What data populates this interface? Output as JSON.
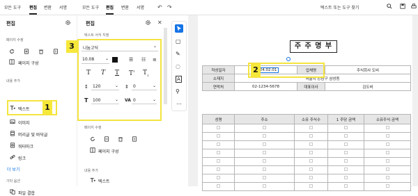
{
  "toolbar": {
    "tabs_left": [
      "모든 도구",
      "편집",
      "변환",
      "서명"
    ],
    "tabs_right": [
      "모든 도구",
      "편집",
      "변환",
      "서명"
    ],
    "search_placeholder": "텍스트 또는 도구 찾기"
  },
  "panel1": {
    "title": "편집",
    "page_section": "페이지 수정",
    "page_layout": "페이지 구성",
    "add_section": "내용 추가",
    "items": [
      "텍스트",
      "이미지",
      "머리글 및 바닥글",
      "워터마크",
      "링크"
    ],
    "more": "더 보기",
    "other_section": "기타 옵션",
    "file_merge": "파일 결합"
  },
  "panel2": {
    "title": "편집",
    "text_format_section": "텍스트 서식 지정",
    "font_name": "나눔고딕",
    "font_size": "10.08",
    "line_spacing": "120",
    "char_spacing": "0",
    "scale": "100",
    "kerning": "0",
    "page_section": "페이지 수정",
    "page_layout": "페이지 구성",
    "add_section": "내용 추가",
    "text_item": "텍스트"
  },
  "document": {
    "title": "주 주 명 부",
    "rows": [
      [
        "작성일자",
        "2024.02.01",
        "업체명",
        "주식회사 도비"
      ],
      [
        "소재지",
        "서울시 강남구 삼성동",
        "",
        ""
      ],
      [
        "연락처",
        "02-1234-5678",
        "대표이사",
        "김도비"
      ]
    ],
    "columns": [
      "성명",
      "주소",
      "소유 주식수",
      "1 주당 금액",
      "소유주식 금액"
    ]
  },
  "annotations": [
    "1",
    "2",
    "3"
  ],
  "colors": {
    "highlight": "#f4e43e",
    "accent": "#1473e6"
  }
}
